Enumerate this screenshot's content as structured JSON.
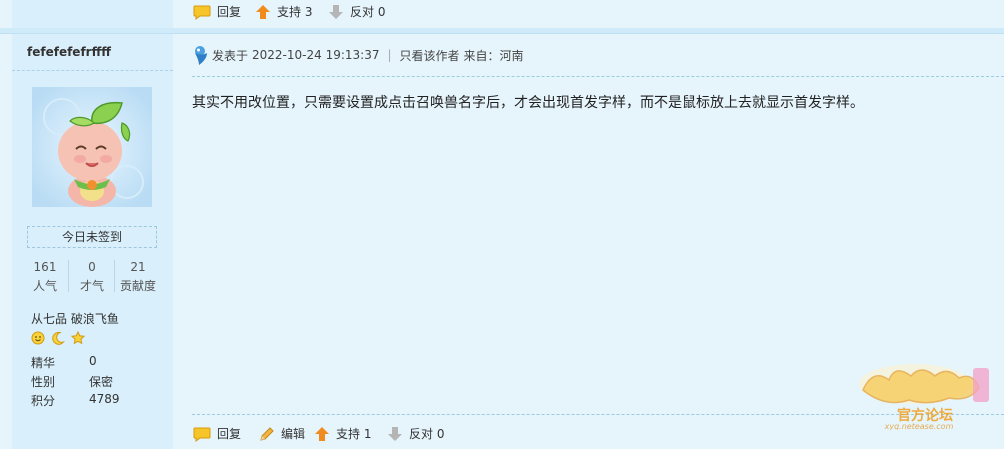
{
  "prev_post": {
    "reply_label": "回复",
    "support_label": "支持 3",
    "oppose_label": "反对 0"
  },
  "author": {
    "name": "fefefefefrffff",
    "signin_label": "今日未签到",
    "stats": [
      {
        "value": "161",
        "label": "人气"
      },
      {
        "value": "0",
        "label": "才气"
      },
      {
        "value": "21",
        "label": "贡献度"
      }
    ],
    "rank": "从七品 破浪飞鱼",
    "medal_icons": [
      "smile-medal-icon",
      "moon-medal-icon",
      "star-medal-icon"
    ],
    "profile": [
      {
        "label": "精华",
        "value": "0"
      },
      {
        "label": "性别",
        "value": "保密"
      },
      {
        "label": "积分",
        "value": "4789"
      }
    ]
  },
  "post": {
    "posted_prefix": "发表于",
    "timestamp": "2022-10-24 19:13:37",
    "only_author_label": "只看该作者",
    "location": "来自：河南",
    "content": "其实不用改位置，只需要设置成点击召唤兽名字后，才会出现首发字样，而不是鼠标放上去就显示首发字样。",
    "actions": {
      "reply_label": "回复",
      "edit_label": "编辑",
      "support_label": "支持 1",
      "oppose_label": "反对 0"
    }
  },
  "watermark": {
    "site_url": "xyq.netease.com",
    "badge_text": "官方论坛"
  },
  "colors": {
    "sidebar_bg": "#d9effb",
    "main_bg": "#e6f4fc",
    "support_arrow": "#f08c1e",
    "oppose_arrow": "#b0b0b0",
    "reply_icon": "#f2b81a"
  }
}
